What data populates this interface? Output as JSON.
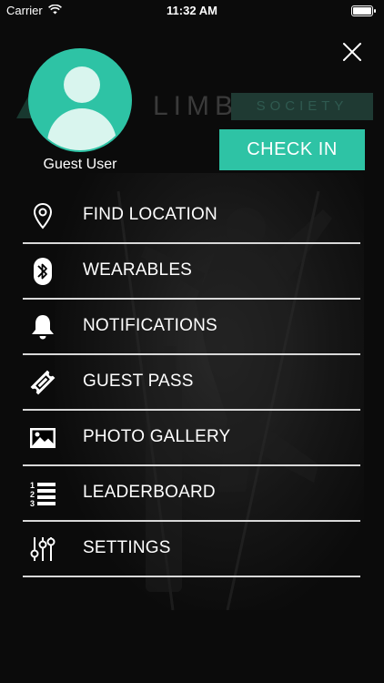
{
  "status_bar": {
    "carrier": "Carrier",
    "time": "11:32 AM"
  },
  "background": {
    "logo_word": "LIMB",
    "logo_tag": "SOCIETY"
  },
  "profile": {
    "name": "Guest User"
  },
  "check_in_label": "CHECK IN",
  "menu": [
    {
      "label": "FIND LOCATION",
      "icon": "location-pin-icon"
    },
    {
      "label": "WEARABLES",
      "icon": "bluetooth-icon"
    },
    {
      "label": "NOTIFICATIONS",
      "icon": "bell-icon"
    },
    {
      "label": "GUEST PASS",
      "icon": "ticket-icon"
    },
    {
      "label": "PHOTO GALLERY",
      "icon": "image-icon"
    },
    {
      "label": "LEADERBOARD",
      "icon": "numbered-list-icon"
    },
    {
      "label": "SETTINGS",
      "icon": "sliders-icon"
    }
  ],
  "colors": {
    "accent": "#2ec3a5",
    "background": "#0b0b0b",
    "divider": "#d8d8d8"
  }
}
